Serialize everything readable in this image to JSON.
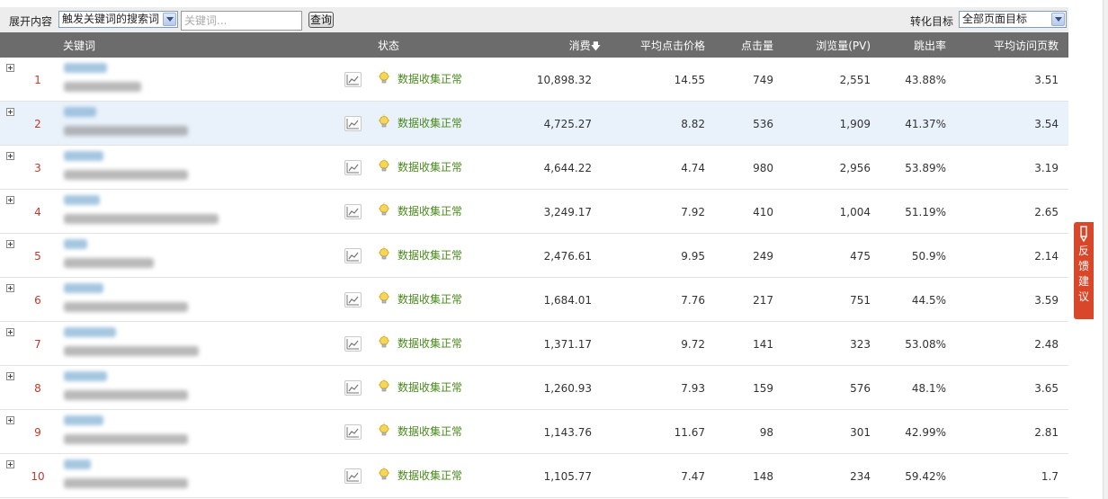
{
  "toolbar": {
    "expand_label": "展开内容",
    "filter_select": "触发关键词的搜索词",
    "keyword_placeholder": "关键词...",
    "query_button": "查询",
    "goal_label": "转化目标",
    "goal_select": "全部页面目标"
  },
  "table": {
    "headers": {
      "keyword": "关键词",
      "status": "状态",
      "cost": "消费",
      "avg_cpc": "平均点击价格",
      "clicks": "点击量",
      "pageviews": "浏览量(PV)",
      "bounce": "跳出率",
      "avg_pages": "平均访问页数"
    },
    "sort_arrow": "🡇",
    "rows": [
      {
        "rank": "1",
        "status": "数据收集正常",
        "cost": "10,898.32",
        "avg_cpc": "14.55",
        "clicks": "749",
        "pageviews": "2,551",
        "bounce": "43.88%",
        "avg_pages": "3.51"
      },
      {
        "rank": "2",
        "status": "数据收集正常",
        "cost": "4,725.27",
        "avg_cpc": "8.82",
        "clicks": "536",
        "pageviews": "1,909",
        "bounce": "41.37%",
        "avg_pages": "3.54"
      },
      {
        "rank": "3",
        "status": "数据收集正常",
        "cost": "4,644.22",
        "avg_cpc": "4.74",
        "clicks": "980",
        "pageviews": "2,956",
        "bounce": "53.89%",
        "avg_pages": "3.19"
      },
      {
        "rank": "4",
        "status": "数据收集正常",
        "cost": "3,249.17",
        "avg_cpc": "7.92",
        "clicks": "410",
        "pageviews": "1,004",
        "bounce": "51.19%",
        "avg_pages": "2.65"
      },
      {
        "rank": "5",
        "status": "数据收集正常",
        "cost": "2,476.61",
        "avg_cpc": "9.95",
        "clicks": "249",
        "pageviews": "475",
        "bounce": "50.9%",
        "avg_pages": "2.14"
      },
      {
        "rank": "6",
        "status": "数据收集正常",
        "cost": "1,684.01",
        "avg_cpc": "7.76",
        "clicks": "217",
        "pageviews": "751",
        "bounce": "44.5%",
        "avg_pages": "3.59"
      },
      {
        "rank": "7",
        "status": "数据收集正常",
        "cost": "1,371.17",
        "avg_cpc": "9.72",
        "clicks": "141",
        "pageviews": "323",
        "bounce": "53.08%",
        "avg_pages": "2.48"
      },
      {
        "rank": "8",
        "status": "数据收集正常",
        "cost": "1,260.93",
        "avg_cpc": "7.93",
        "clicks": "159",
        "pageviews": "576",
        "bounce": "48.1%",
        "avg_pages": "3.65"
      },
      {
        "rank": "9",
        "status": "数据收集正常",
        "cost": "1,143.76",
        "avg_cpc": "11.67",
        "clicks": "98",
        "pageviews": "301",
        "bounce": "42.99%",
        "avg_pages": "2.81"
      },
      {
        "rank": "10",
        "status": "数据收集正常",
        "cost": "1,105.77",
        "avg_cpc": "7.47",
        "clicks": "148",
        "pageviews": "234",
        "bounce": "59.42%",
        "avg_pages": "1.7"
      }
    ]
  },
  "feedback": {
    "chars": [
      "反",
      "馈",
      "建",
      "议"
    ]
  },
  "colors": {
    "header_bg": "#6c6c6c",
    "status_green": "#4a8a1c",
    "rank_red": "#c0392b",
    "feedback_bg": "#d9472b",
    "highlight_row": "#e9f1fb"
  },
  "icons": {
    "expand": "plus-box-icon",
    "trend": "line-chart-icon",
    "status": "lightbulb-icon",
    "sort": "arrow-down-icon",
    "feedback": "pen-icon"
  }
}
